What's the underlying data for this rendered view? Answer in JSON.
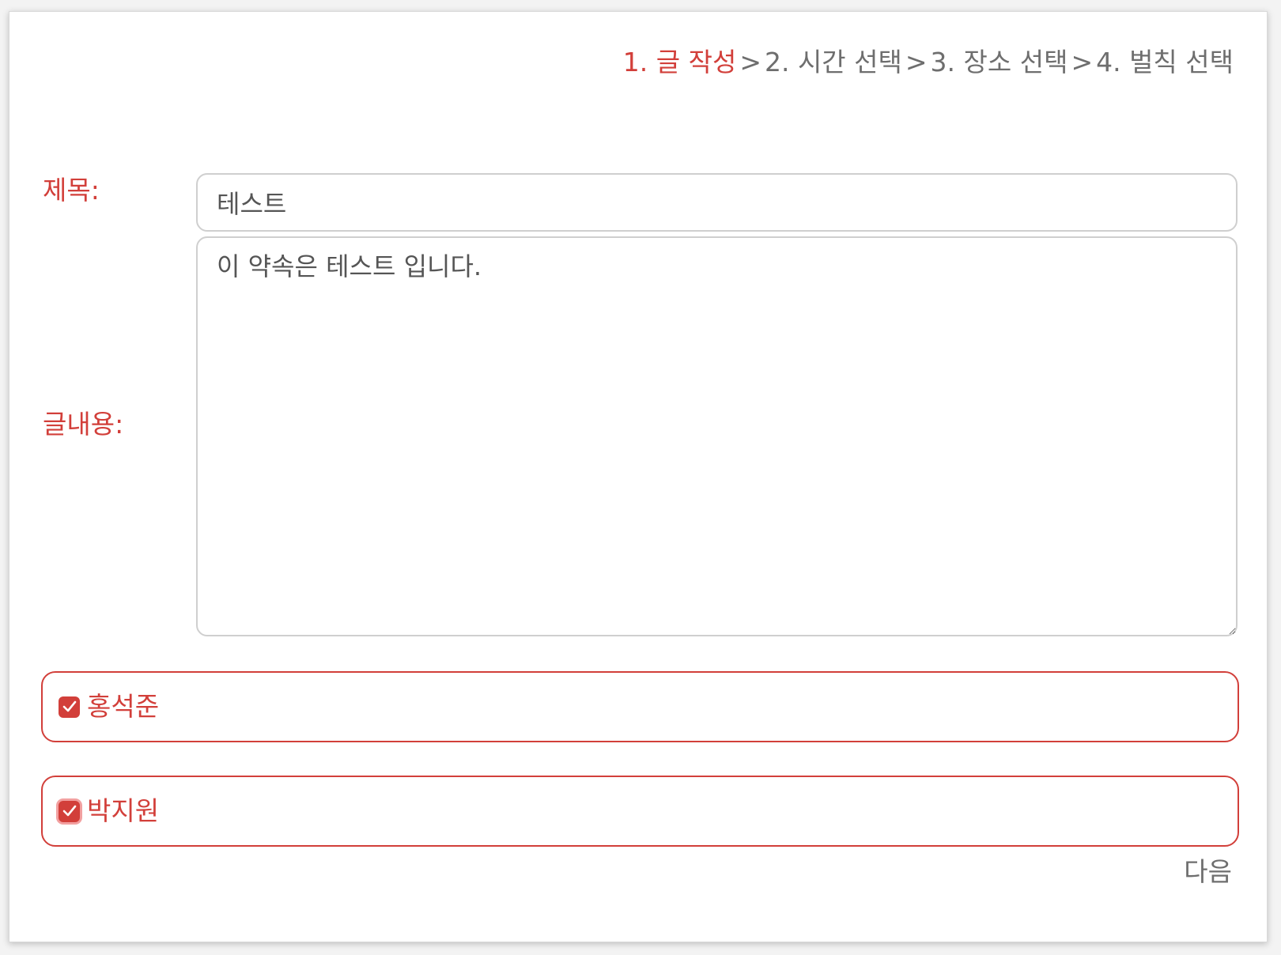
{
  "steps": {
    "step1": "1. 글 작성",
    "separator": ">",
    "step2": "2. 시간 선택",
    "step3": "3. 장소 선택",
    "step4": "4. 벌칙 선택",
    "active_color": "#d23f3a",
    "inactive_color": "#6e6e6e"
  },
  "form": {
    "title_label": "제목:",
    "title_value": "테스트",
    "content_label": "글내용:",
    "content_value": "이 약속은 테스트 입니다."
  },
  "members": [
    {
      "name": "홍석준",
      "checked": true
    },
    {
      "name": "박지원",
      "checked": true
    }
  ],
  "next_label": "다음",
  "accent_color": "#d23f3a"
}
